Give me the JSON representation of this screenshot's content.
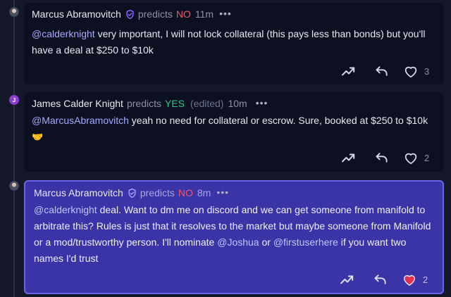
{
  "comments": [
    {
      "author": "Marcus Abramovitch",
      "predicts_label": "predicts",
      "outcome": "NO",
      "edited": "",
      "time": "11m",
      "more": "•••",
      "body": {
        "mention": "@calderknight",
        "text": " very important, I will not lock collateral (this pays less than bonds) but you'll have a deal at $250 to $10k"
      },
      "likes": "3",
      "liked": false
    },
    {
      "author": "James Calder Knight",
      "avatar_letter": "J",
      "predicts_label": "predicts",
      "outcome": "YES",
      "edited": "(edited)",
      "time": "10m",
      "more": "•••",
      "body": {
        "mention": "@MarcusAbramovitch",
        "text": " yeah no need for collateral or escrow. Sure, booked at $250 to $10k",
        "emoji": "🤝"
      },
      "likes": "2",
      "liked": false
    },
    {
      "author": "Marcus Abramovitch",
      "predicts_label": "predicts",
      "outcome": "NO",
      "edited": "",
      "time": "8m",
      "more": "•••",
      "body": {
        "mention1": "@calderknight",
        "text1": " deal. Want to dm me on discord and we can get someone from manifold to arbitrate this? Rules is just that it resolves to the market but maybe someone from Manifold or a mod/trustworthy person. I'll nominate ",
        "mention2": "@Joshua",
        "text2": " or ",
        "mention3": "@firstuserhere",
        "text3": " if you want two names I'd trust"
      },
      "likes": "2",
      "liked": true
    }
  ],
  "colors": {
    "background": "#151829",
    "card": "#0d1020",
    "highlight_card": "#3a34a6",
    "no": "#f0576a",
    "yes": "#2fc38e",
    "mention": "#a3a9ff",
    "liked_heart": "#e0324b"
  },
  "icons": {
    "verified": "shield-check-icon",
    "repost": "trending-up-icon",
    "reply": "reply-arrow-icon",
    "like": "heart-icon"
  }
}
